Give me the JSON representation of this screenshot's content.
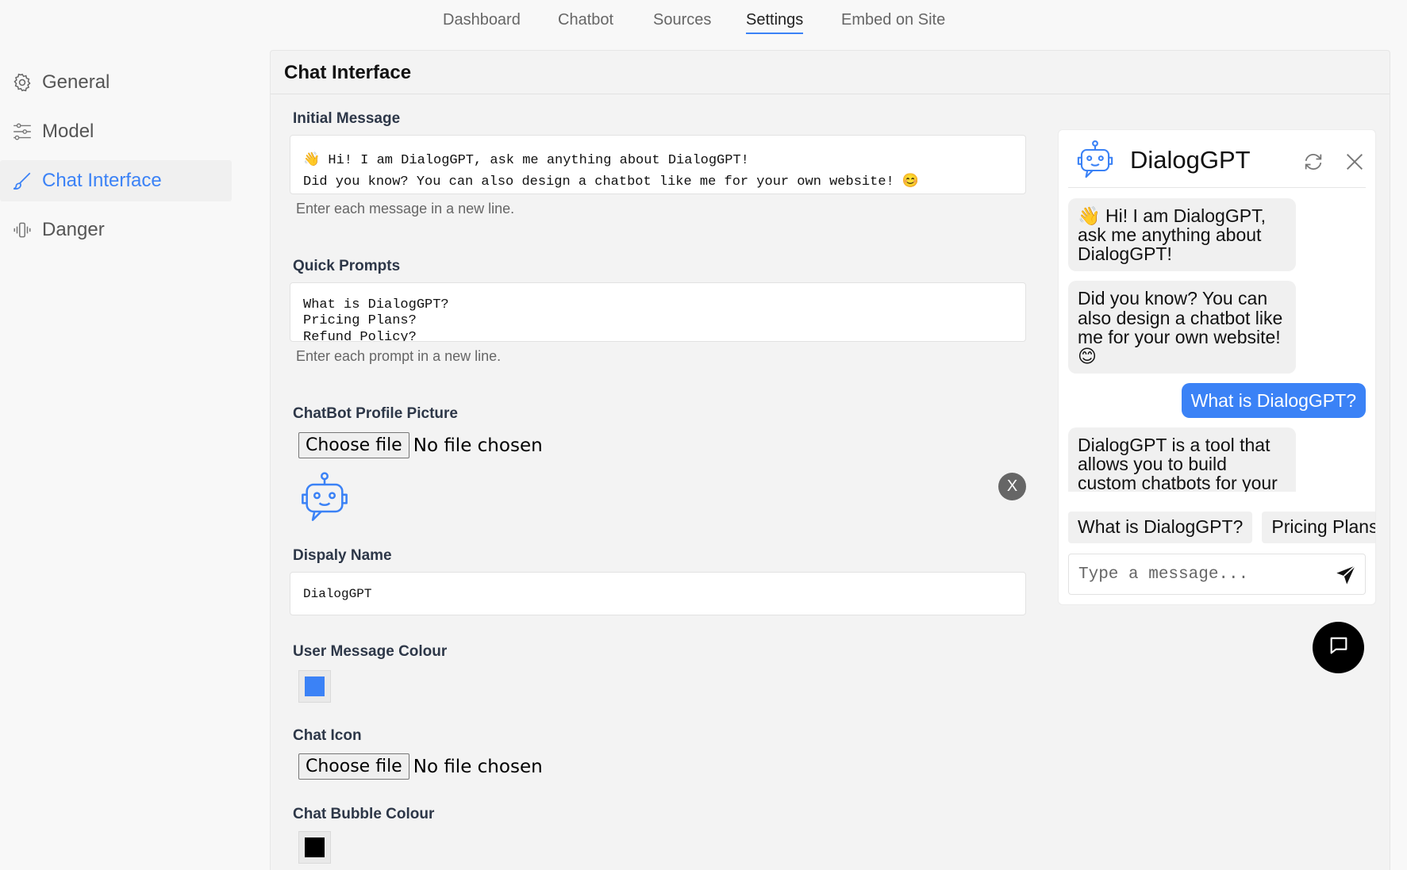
{
  "topnav": {
    "tabs": [
      {
        "label": "Dashboard"
      },
      {
        "label": "Chatbot"
      },
      {
        "label": "Sources"
      },
      {
        "label": "Settings"
      },
      {
        "label": "Embed on Site"
      }
    ],
    "active": "Settings"
  },
  "sidebar": {
    "items": [
      {
        "label": "General",
        "icon": "gear-icon"
      },
      {
        "label": "Model",
        "icon": "sliders-icon"
      },
      {
        "label": "Chat Interface",
        "icon": "brush-icon"
      },
      {
        "label": "Danger",
        "icon": "vibration-icon"
      }
    ],
    "active": "Chat Interface"
  },
  "panel": {
    "title": "Chat Interface",
    "initial_message": {
      "label": "Initial Message",
      "line1": "👋 Hi! I am DialogGPT, ask me anything about DialogGPT!",
      "line2": "Did you know? You can also design a chatbot like me for your own website! 😊",
      "help": "Enter each message in a new line."
    },
    "quick_prompts": {
      "label": "Quick Prompts",
      "line1": "What is DialogGPT?",
      "line2": "Pricing Plans?",
      "line3": "Refund Policy?",
      "help": "Enter each prompt in a new line."
    },
    "profile_picture": {
      "label": "ChatBot Profile Picture",
      "button": "Choose file",
      "status": "No file chosen",
      "remove_label": "X"
    },
    "display_name": {
      "label": "Dispaly Name",
      "value": "DialogGPT"
    },
    "user_message_colour": {
      "label": "User Message Colour",
      "color": "#3b82f6"
    },
    "chat_icon": {
      "label": "Chat Icon",
      "button": "Choose file",
      "status": "No file chosen"
    },
    "chat_bubble_colour": {
      "label": "Chat Bubble Colour",
      "color": "#000000"
    }
  },
  "chat": {
    "title": "DialogGPT",
    "messages": [
      {
        "role": "bot",
        "text": "👋 Hi! I am DialogGPT, ask me anything about DialogGPT!"
      },
      {
        "role": "bot",
        "text": "Did you know? You can also design a chatbot like me for your own website! 😊"
      },
      {
        "role": "user",
        "text": "What is DialogGPT?"
      },
      {
        "role": "bot",
        "text": "DialogGPT is a tool that allows you to build custom chatbots for your"
      }
    ],
    "prompts": [
      "What is DialogGPT?",
      "Pricing Plans?"
    ],
    "input_placeholder": "Type a message..."
  },
  "colors": {
    "accent": "#3b82f6",
    "launcher": "#000000"
  }
}
